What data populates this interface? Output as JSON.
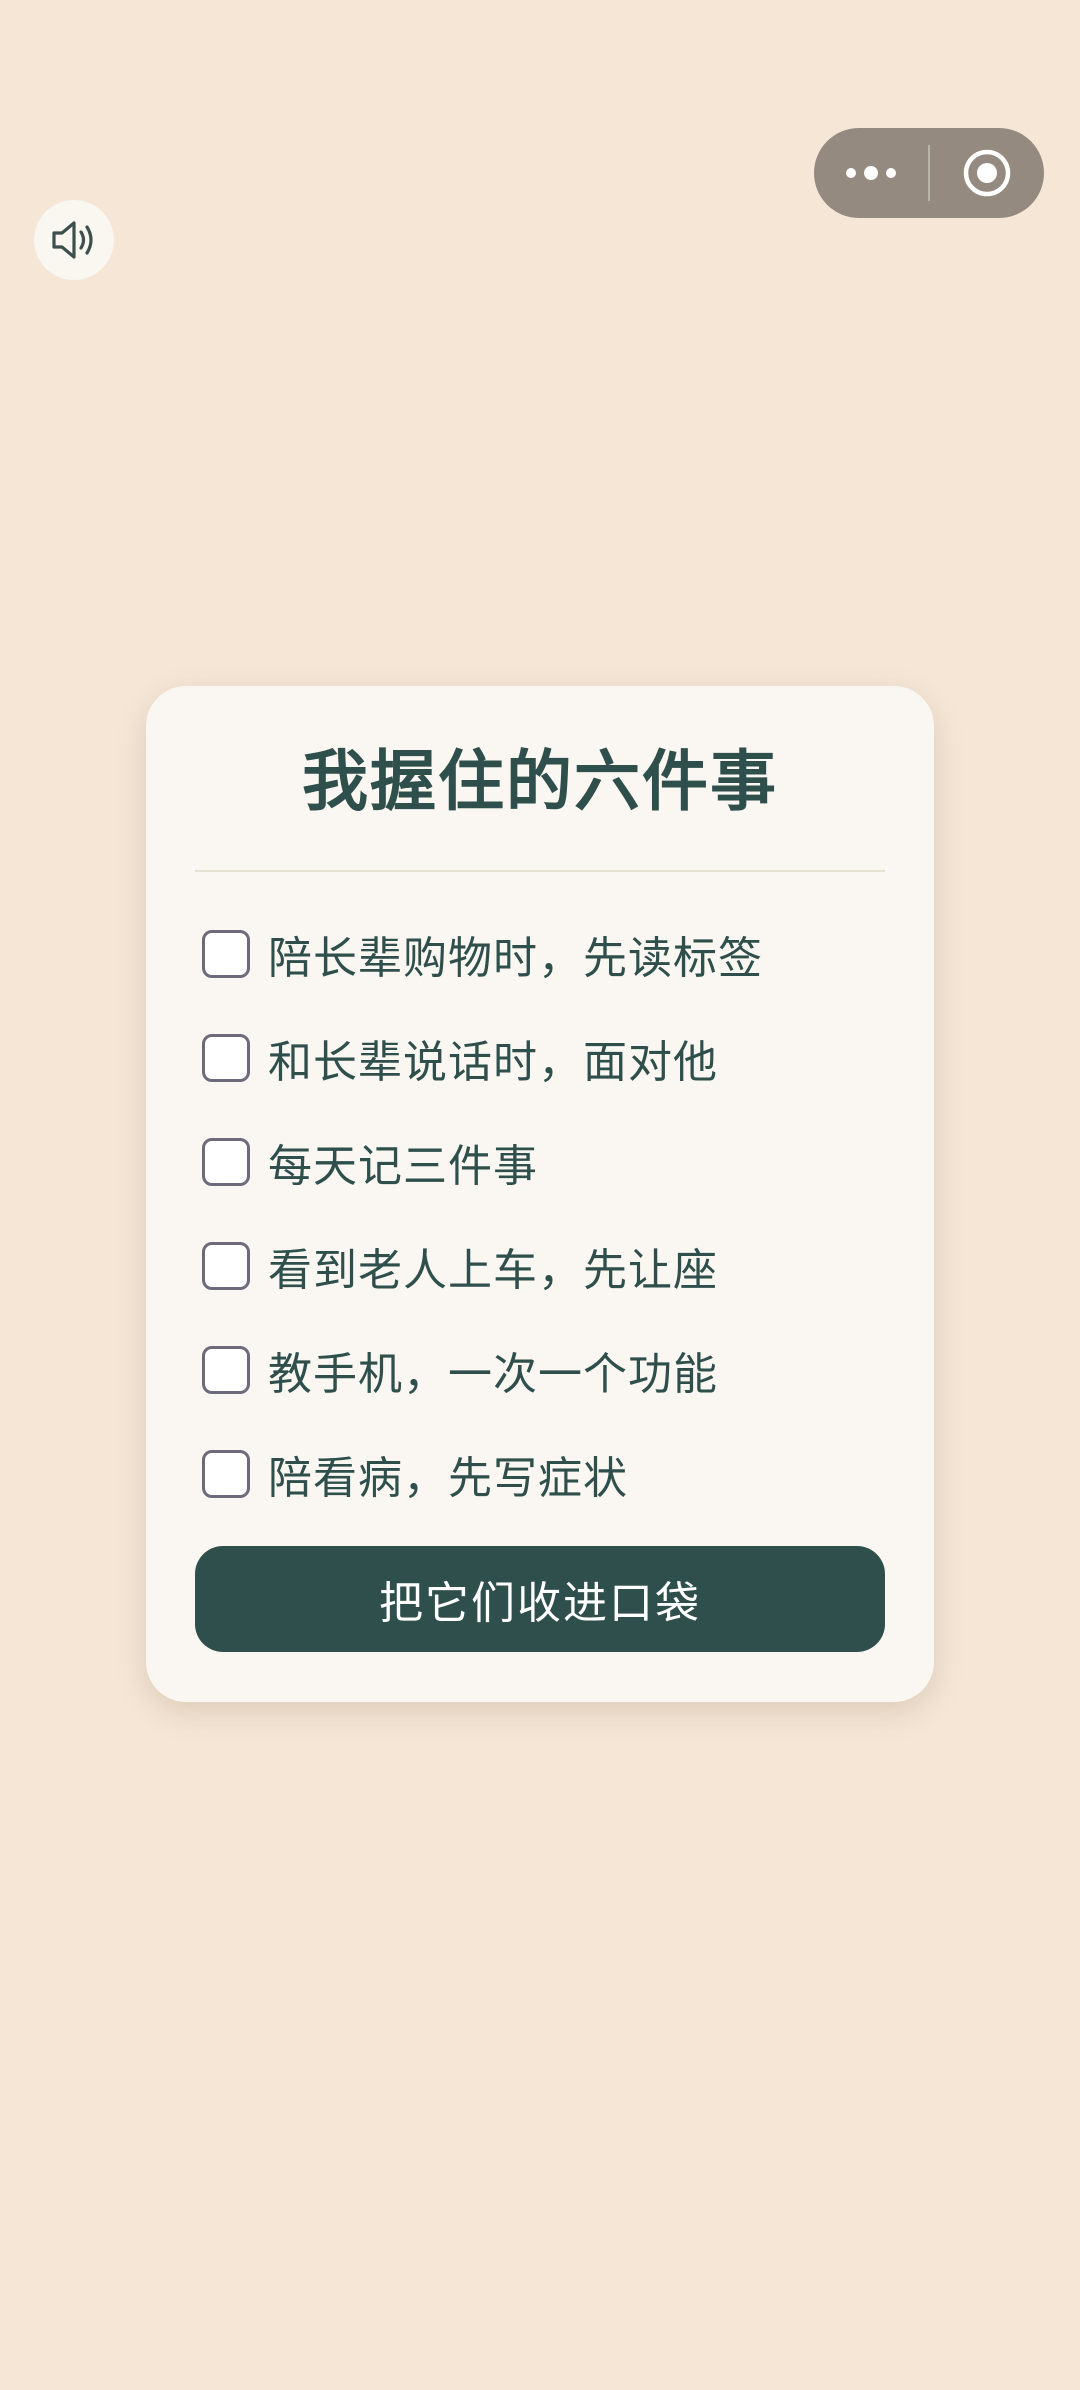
{
  "capsule": {
    "more_icon": "more-dots-icon",
    "close_icon": "record-circle-icon",
    "background_color": "#948a7f"
  },
  "sound": {
    "icon": "speaker-icon"
  },
  "card": {
    "title": "我握住的六件事",
    "items": [
      {
        "label": "陪长辈购物时，先读标签",
        "checked": false
      },
      {
        "label": "和长辈说话时，面对他",
        "checked": false
      },
      {
        "label": "每天记三件事",
        "checked": false
      },
      {
        "label": "看到老人上车，先让座",
        "checked": false
      },
      {
        "label": "教手机，一次一个功能",
        "checked": false
      },
      {
        "label": "陪看病，先写症状",
        "checked": false
      }
    ],
    "button_label": "把它们收进口袋"
  },
  "colors": {
    "background": "#f5e6d6",
    "card": "#faf6f1",
    "accent": "#2f4f4c",
    "checkbox_border": "#6d6a7c"
  }
}
